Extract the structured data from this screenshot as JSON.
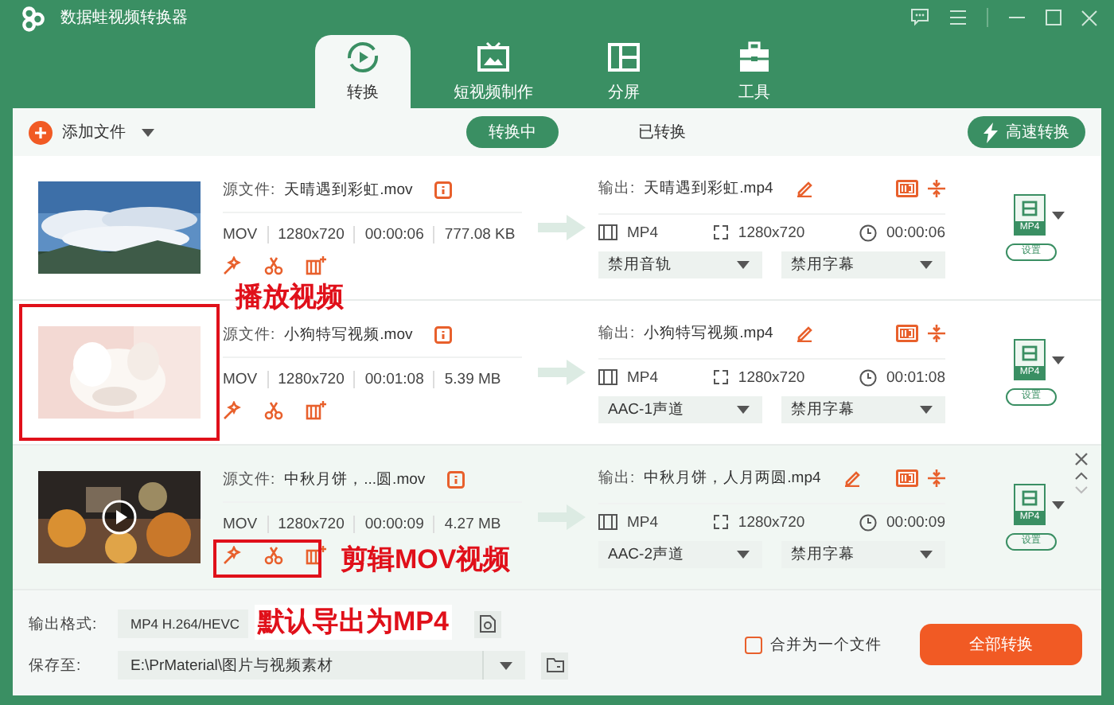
{
  "window": {
    "title": "数据蛙视频转换器"
  },
  "tabs": [
    {
      "label": "转换",
      "kind": "convert",
      "selected": true
    },
    {
      "label": "短视频制作",
      "kind": "tv",
      "selected": false
    },
    {
      "label": "分屏",
      "kind": "split",
      "selected": false
    },
    {
      "label": "工具",
      "kind": "toolbox",
      "selected": false
    }
  ],
  "toolbar": {
    "add_file": "添加文件",
    "filters": [
      {
        "label": "转换中",
        "selected": true
      },
      {
        "label": "已转换",
        "selected": false
      }
    ],
    "fast_convert": "高速转换"
  },
  "files": [
    {
      "hovered": false,
      "thumbnail_marked": false,
      "actions_marked": false,
      "source_label": "源文件:",
      "name": "天晴遇到彩虹.mov",
      "format": "MOV",
      "resolution": "1280x720",
      "duration": "00:00:06",
      "size": "777.08 KB",
      "output_label": "输出:",
      "output_name": "天晴遇到彩虹.mp4",
      "out_format": "MP4",
      "out_resolution": "1280x720",
      "out_duration": "00:00:06",
      "audio": "禁用音轨",
      "subtitle": "禁用字幕",
      "badge": "MP4",
      "settings": "设置"
    },
    {
      "hovered": false,
      "thumbnail_marked": true,
      "actions_marked": false,
      "source_label": "源文件:",
      "name": "小狗特写视频.mov",
      "format": "MOV",
      "resolution": "1280x720",
      "duration": "00:01:08",
      "size": "5.39 MB",
      "output_label": "输出:",
      "output_name": "小狗特写视频.mp4",
      "out_format": "MP4",
      "out_resolution": "1280x720",
      "out_duration": "00:01:08",
      "audio": "AAC-1声道",
      "subtitle": "禁用字幕",
      "badge": "MP4",
      "settings": "设置"
    },
    {
      "hovered": true,
      "thumbnail_marked": false,
      "actions_marked": true,
      "source_label": "源文件:",
      "name": "中秋月饼，...圆.mov",
      "format": "MOV",
      "resolution": "1280x720",
      "duration": "00:00:09",
      "size": "4.27 MB",
      "output_label": "输出:",
      "output_name": "中秋月饼，人月两圆.mp4",
      "out_format": "MP4",
      "out_resolution": "1280x720",
      "out_duration": "00:00:09",
      "audio": "AAC-2声道",
      "subtitle": "禁用字幕",
      "badge": "MP4",
      "settings": "设置"
    }
  ],
  "bottom": {
    "format_label": "输出格式:",
    "format_value": "MP4 H.264/HEVC",
    "save_label": "保存至:",
    "save_path": "E:\\PrMaterial\\图片与视频素材",
    "merge": {
      "label": "合并为一个文件",
      "checked": false
    },
    "convert_all": "全部转换"
  },
  "annotations": [
    "播放视频",
    "剪辑MOV视频",
    "默认导出为MP4"
  ]
}
